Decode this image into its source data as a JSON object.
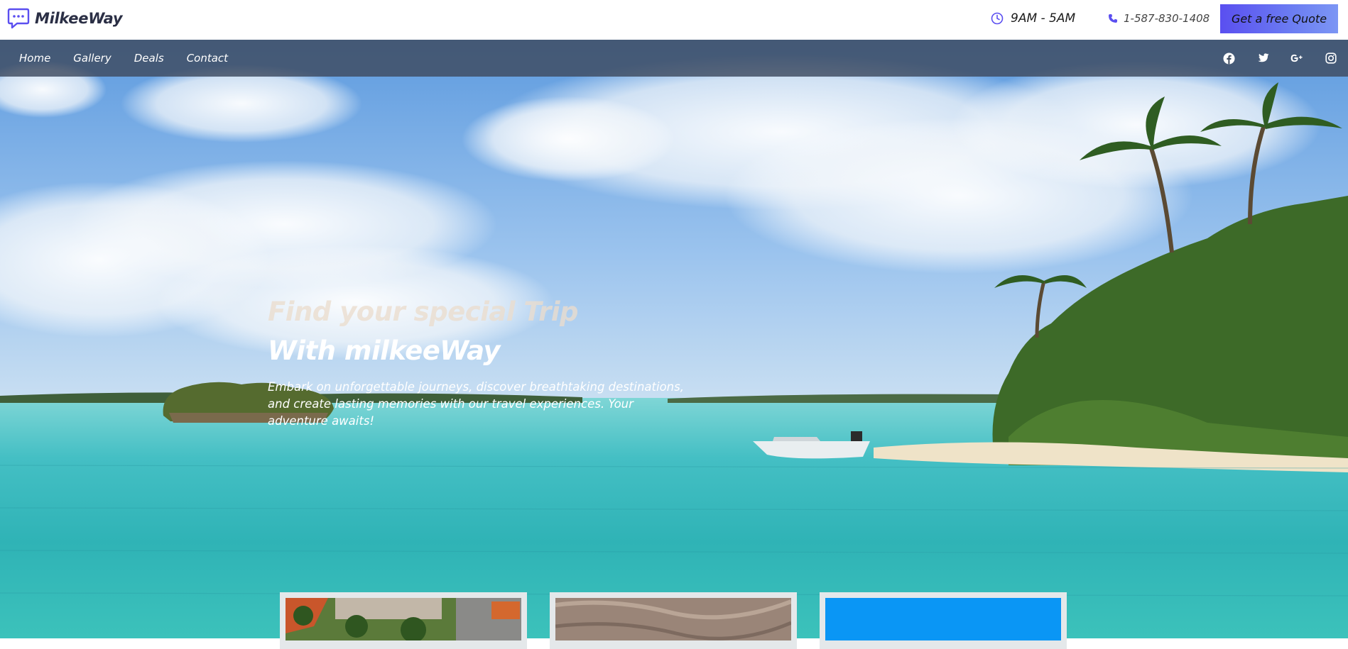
{
  "brand": {
    "name": "MilkeeWay",
    "accent": "#5b4ff0"
  },
  "header": {
    "hours": "9AM - 5AM",
    "phone": "1-587-830-1408",
    "quote_button": "Get a free Quote"
  },
  "nav": {
    "links": [
      "Home",
      "Gallery",
      "Deals",
      "Contact"
    ],
    "socials": [
      "facebook-icon",
      "twitter-icon",
      "google-plus-icon",
      "instagram-icon"
    ]
  },
  "hero": {
    "title_line1": "Find your special Trip",
    "title_line2": "With milkeeWay",
    "description": "Embark on unforgettable journeys, discover breathtaking destinations, and create lasting memories with our travel experiences. Your adventure awaits!"
  },
  "cards": [
    {
      "name": "resort-card"
    },
    {
      "name": "canyon-card"
    },
    {
      "name": "blue-card"
    }
  ]
}
